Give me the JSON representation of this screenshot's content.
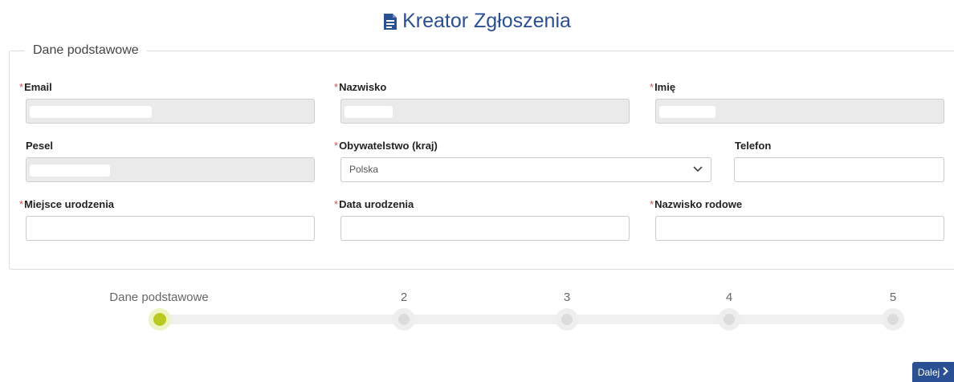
{
  "header": {
    "title": "Kreator Zgłoszenia",
    "icon": "document-icon"
  },
  "section": {
    "legend": "Dane podstawowe"
  },
  "fields": {
    "email": {
      "label": "Email",
      "required": "*",
      "value": ""
    },
    "nazwisko": {
      "label": "Nazwisko",
      "required": "*",
      "value": ""
    },
    "imie": {
      "label": "Imię",
      "required": "*",
      "value": ""
    },
    "pesel": {
      "label": "Pesel",
      "value": ""
    },
    "obywatelstwo": {
      "label": "Obywatelstwo (kraj)",
      "required": "*",
      "value": "Polska"
    },
    "telefon": {
      "label": "Telefon",
      "value": ""
    },
    "miejsce_urodzenia": {
      "label": "Miejsce urodzenia",
      "required": "*",
      "value": ""
    },
    "data_urodzenia": {
      "label": "Data urodzenia",
      "required": "*",
      "value": ""
    },
    "nazwisko_rodowe": {
      "label": "Nazwisko rodowe",
      "required": "*",
      "value": ""
    }
  },
  "stepper": {
    "steps": [
      {
        "label": "Dane podstawowe",
        "active": true
      },
      {
        "label": "2",
        "active": false
      },
      {
        "label": "3",
        "active": false
      },
      {
        "label": "4",
        "active": false
      },
      {
        "label": "5",
        "active": false
      }
    ],
    "active_color": "#b9c91f"
  },
  "buttons": {
    "next_label": "Dalej"
  },
  "colors": {
    "accent": "#2b4f93",
    "required": "#d9534f"
  }
}
